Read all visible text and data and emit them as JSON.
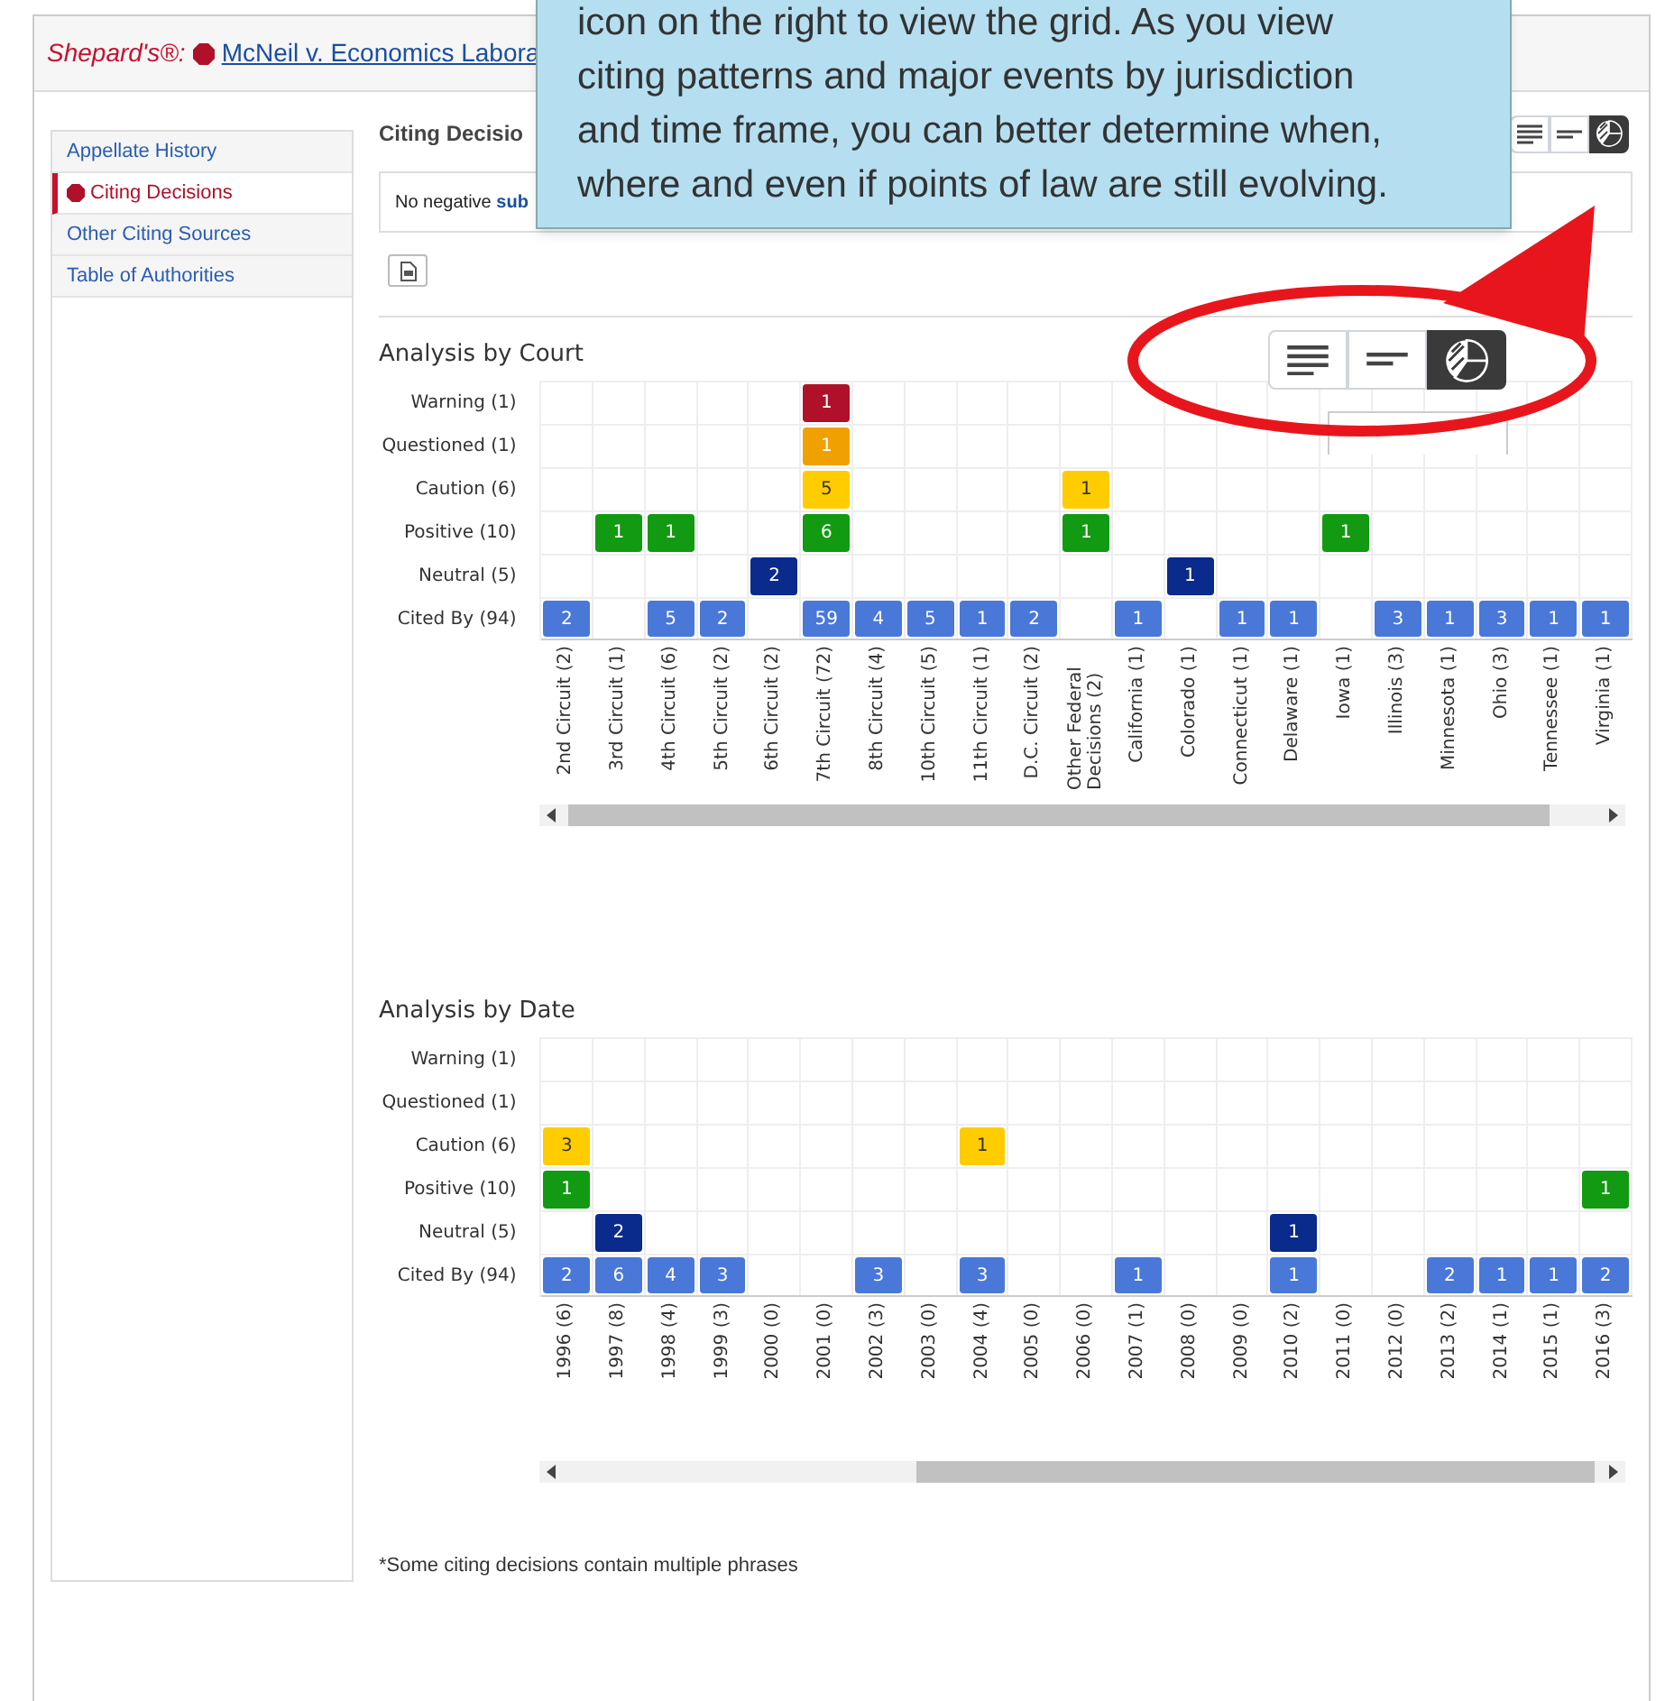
{
  "header": {
    "brand": "Shepard's®:",
    "case_link": "McNeil v. Economics Labora"
  },
  "sidebar": {
    "items": [
      {
        "label": "Appellate History",
        "selected": false
      },
      {
        "label": "Citing Decisions",
        "selected": true
      },
      {
        "label": "Other Citing Sources",
        "selected": false
      },
      {
        "label": "Table of Authorities",
        "selected": false
      }
    ]
  },
  "section_title": "Citing Decisio",
  "notice": {
    "text": "No negative",
    "link": "sub"
  },
  "view_toggle": {
    "options": [
      {
        "kind": "list",
        "selected": false
      },
      {
        "kind": "summary",
        "selected": false
      },
      {
        "kind": "grid",
        "selected": true
      }
    ]
  },
  "analyses": [
    {
      "title": "Analysis by Court",
      "rows": [
        {
          "label": "Warning (1)",
          "color": "#b0102a",
          "cells": [
            null,
            null,
            null,
            null,
            null,
            "1",
            null,
            null,
            null,
            null,
            null,
            null,
            null,
            null,
            null,
            null,
            null,
            null,
            null,
            null,
            null
          ]
        },
        {
          "label": "Questioned (1)",
          "color": "#f0a000",
          "cells": [
            null,
            null,
            null,
            null,
            null,
            "1",
            null,
            null,
            null,
            null,
            null,
            null,
            null,
            null,
            null,
            null,
            null,
            null,
            null,
            null,
            null
          ]
        },
        {
          "label": "Caution (6)",
          "color": "#ffcc00",
          "cells": [
            null,
            null,
            null,
            null,
            null,
            "5",
            null,
            null,
            null,
            null,
            "1",
            null,
            null,
            null,
            null,
            null,
            null,
            null,
            null,
            null,
            null
          ]
        },
        {
          "label": "Positive (10)",
          "color": "#129a12",
          "cells": [
            null,
            "1",
            "1",
            null,
            null,
            "6",
            null,
            null,
            null,
            null,
            "1",
            null,
            null,
            null,
            null,
            "1",
            null,
            null,
            null,
            null,
            null
          ]
        },
        {
          "label": "Neutral (5)",
          "color": "#0a2a8c",
          "cells": [
            null,
            null,
            null,
            null,
            "2",
            null,
            null,
            null,
            null,
            null,
            null,
            null,
            "1",
            null,
            null,
            null,
            null,
            null,
            null,
            null,
            null
          ]
        },
        {
          "label": "Cited By (94)",
          "color": "#4a78d8",
          "cells": [
            "2",
            null,
            "5",
            "2",
            null,
            "59",
            "4",
            "5",
            "1",
            "2",
            null,
            "1",
            null,
            "1",
            "1",
            null,
            "3",
            "1",
            "3",
            "1",
            "1"
          ]
        }
      ],
      "axis_labels": [
        "2nd Circuit (2)",
        "3rd Circuit (1)",
        "4th Circuit (6)",
        "5th Circuit (2)",
        "6th Circuit (2)",
        "7th Circuit (72)",
        "8th Circuit (4)",
        "10th Circuit (5)",
        "11th Circuit (1)",
        "D.C. Circuit (2)",
        "Other Federal Decisions (2)",
        "California (1)",
        "Colorado (1)",
        "Connecticut (1)",
        "Delaware (1)",
        "Iowa (1)",
        "Illinois (3)",
        "Minnesota (1)",
        "Ohio (3)",
        "Tennessee (1)",
        "Virginia (1)"
      ]
    },
    {
      "title": "Analysis by Date",
      "rows": [
        {
          "label": "Warning (1)",
          "cells": [
            null,
            null,
            null,
            null,
            null,
            null,
            null,
            null,
            null,
            null,
            null,
            null,
            null,
            null,
            null,
            null,
            null,
            null,
            null,
            null,
            null
          ]
        },
        {
          "label": "Questioned (1)",
          "cells": [
            null,
            null,
            null,
            null,
            null,
            null,
            null,
            null,
            null,
            null,
            null,
            null,
            null,
            null,
            null,
            null,
            null,
            null,
            null,
            null,
            null
          ]
        },
        {
          "label": "Caution (6)",
          "color": "#ffcc00",
          "cells": [
            "3",
            null,
            null,
            null,
            null,
            null,
            null,
            null,
            "1",
            null,
            null,
            null,
            null,
            null,
            null,
            null,
            null,
            null,
            null,
            null,
            null
          ]
        },
        {
          "label": "Positive (10)",
          "color": "#129a12",
          "cells": [
            "1",
            null,
            null,
            null,
            null,
            null,
            null,
            null,
            null,
            null,
            null,
            null,
            null,
            null,
            null,
            null,
            null,
            null,
            null,
            null,
            "1"
          ]
        },
        {
          "label": "Neutral (5)",
          "color": "#0a2a8c",
          "cells": [
            null,
            "2",
            null,
            null,
            null,
            null,
            null,
            null,
            null,
            null,
            null,
            null,
            null,
            null,
            "1",
            null,
            null,
            null,
            null,
            null,
            null
          ]
        },
        {
          "label": "Cited By (94)",
          "color": "#4a78d8",
          "cells": [
            "2",
            "6",
            "4",
            "3",
            null,
            null,
            "3",
            null,
            "3",
            null,
            null,
            "1",
            null,
            null,
            "1",
            null,
            null,
            "2",
            "1",
            "1",
            "2"
          ]
        }
      ],
      "axis_labels": [
        "1996 (6)",
        "1997 (8)",
        "1998 (4)",
        "1999 (3)",
        "2000 (0)",
        "2001 (0)",
        "2002 (3)",
        "2003 (0)",
        "2004 (4)",
        "2005 (0)",
        "2006 (0)",
        "2007 (1)",
        "2008 (0)",
        "2009 (0)",
        "2010 (2)",
        "2011 (0)",
        "2012 (0)",
        "2013 (2)",
        "2014 (1)",
        "2015 (1)",
        "2016 (3)"
      ]
    }
  ],
  "footnote": "*Some citing decisions contain multiple phrases",
  "tooltip": {
    "lines": [
      "icon on the right to view the grid. As you view",
      "citing patterns and major events by jurisdiction",
      "and time frame, you can better determine when,",
      "where and even if points of law are still evolving."
    ]
  }
}
